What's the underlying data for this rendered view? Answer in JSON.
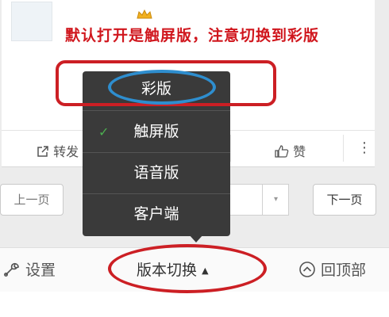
{
  "post": {
    "notice": "默认打开是触屏版，注意切换到彩版",
    "share_label": "转发",
    "like_label": "赞",
    "more_label": "⋮"
  },
  "pager": {
    "prev_label": "上一页",
    "next_label": "下一页",
    "select_caret": "▾"
  },
  "version_menu": {
    "items": [
      {
        "label": "彩版",
        "selected": false
      },
      {
        "label": "触屏版",
        "selected": true
      },
      {
        "label": "语音版",
        "selected": false
      },
      {
        "label": "客户端",
        "selected": false
      }
    ],
    "check_mark": "✓"
  },
  "footer": {
    "settings_label": "设置",
    "version_switch_label": "版本切换",
    "version_switch_caret": "▲",
    "back_to_top_label": "回顶部"
  },
  "annotations": {
    "highlight_color": "#cc1f24",
    "focus_color": "#2e8ecf"
  },
  "icons": [
    "avatar-image",
    "crown-icon",
    "share-icon",
    "thumbs-up-icon",
    "more-icon",
    "checkmark-icon",
    "wrench-icon",
    "circle-up-icon"
  ]
}
